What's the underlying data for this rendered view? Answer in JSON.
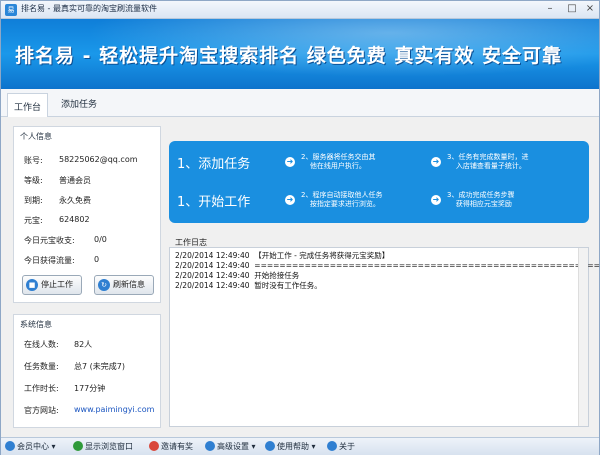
{
  "window": {
    "title": "排名易 - 最真实可靠的淘宝刷流量软件",
    "icon_text": "易"
  },
  "banner": {
    "text": "排名易 - 轻松提升淘宝搜索排名   绿色免费  真实有效  安全可靠"
  },
  "tabs": [
    {
      "label": "工作台"
    },
    {
      "label": "添加任务"
    }
  ],
  "personal": {
    "title": "个人信息",
    "rows": [
      {
        "label": "账号:",
        "value": "58225062@qq.com"
      },
      {
        "label": "等级:",
        "value": "普通会员"
      },
      {
        "label": "到期:",
        "value": "永久免费"
      },
      {
        "label": "元宝:",
        "value": "624802"
      },
      {
        "label": "今日元宝收支:",
        "value": "0/0"
      },
      {
        "label": "今日获得流量:",
        "value": "0"
      }
    ],
    "stop_button": "停止工作",
    "refresh_button": "刷新信息"
  },
  "system": {
    "title": "系统信息",
    "rows": [
      {
        "label": "在线人数:",
        "value": "82人"
      },
      {
        "label": "任务数量:",
        "value": "总7 (未完成7)"
      },
      {
        "label": "工作时长:",
        "value": "177分钟"
      },
      {
        "label": "官方网站:",
        "value": "www.paimingyi.com"
      }
    ]
  },
  "guide": {
    "step1_big": "1、添加任务",
    "step2_small": "2、服务器将任务交由其\n    他在线用户执行。",
    "step3_small": "3、任务有完成数量时，进\n    入店铺查看量子统计。",
    "step1b_big": "1、开始工作",
    "step2b_small": "2、程序自动接取他人任务\n    按指定要求进行浏览。",
    "step3b_small": "3、成功完成任务步骤\n    获得相应元宝奖励"
  },
  "log": {
    "title": "工作日志",
    "lines": [
      "2/20/2014 12:49:40  【开始工作 - 完成任务将获得元宝奖励】",
      "2/20/2014 12:49:40  ==========================================================",
      "2/20/2014 12:49:40  开始抢接任务",
      "2/20/2014 12:49:40  暂时没有工作任务。"
    ]
  },
  "statusbar": [
    {
      "label": "会员中心 ▾",
      "color": "#2f7fd1"
    },
    {
      "label": "显示浏览窗口",
      "color": "#2f9a3a"
    },
    {
      "label": "邀请有奖",
      "color": "#d9463a"
    },
    {
      "label": "高级设置 ▾",
      "color": "#2f7fd1"
    },
    {
      "label": "使用帮助 ▾",
      "color": "#2f7fd1"
    },
    {
      "label": "关于",
      "color": "#2f7fd1"
    }
  ],
  "colors": {
    "banner": "#1a8fe0",
    "link": "#1a55c0"
  }
}
